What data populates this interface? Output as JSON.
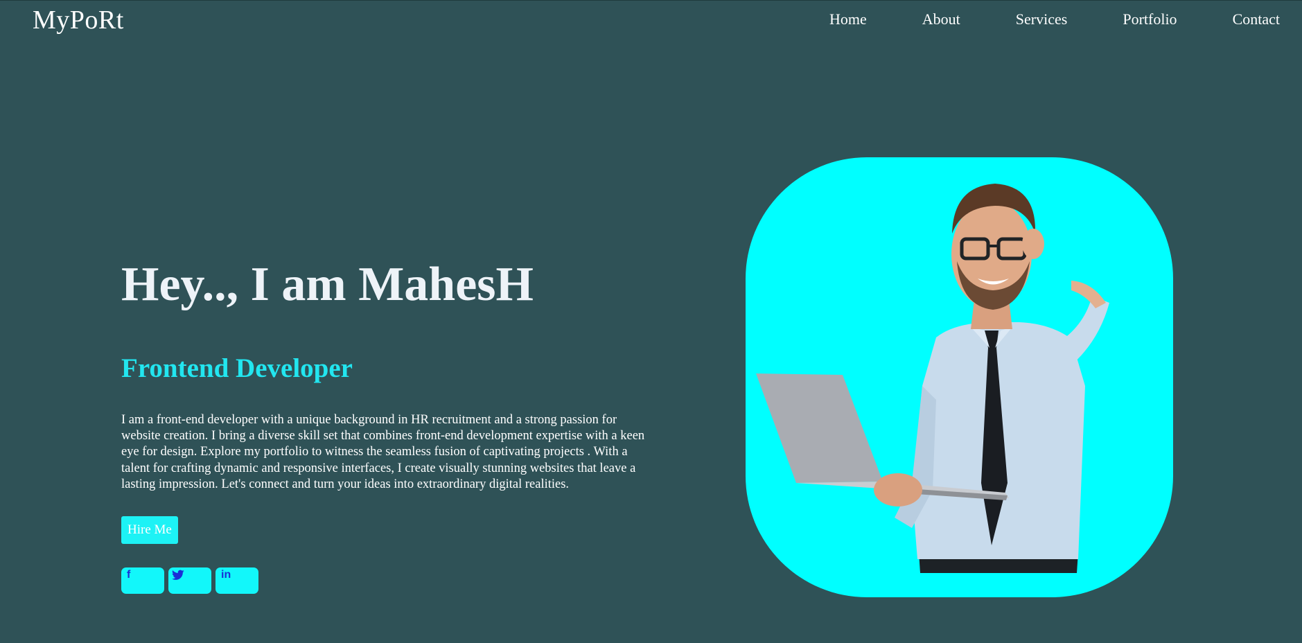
{
  "brand": {
    "logo_text": "MyPoRt"
  },
  "nav": {
    "items": [
      {
        "label": "Home"
      },
      {
        "label": "About"
      },
      {
        "label": "Services"
      },
      {
        "label": "Portfolio"
      },
      {
        "label": "Contact"
      }
    ]
  },
  "hero": {
    "title": "Hey.., I am MahesH",
    "subtitle": "Frontend Developer",
    "description": "I am a front-end developer with a unique background in HR recruitment and a strong passion for website creation. I bring a diverse skill set that combines front-end development expertise with a keen eye for design. Explore my portfolio to witness the seamless fusion of captivating projects . With a talent for crafting dynamic and responsive interfaces, I create visually stunning websites that leave a lasting impression. Let's connect and turn your ideas into extraordinary digital realities.",
    "hire_button_label": "Hire Me"
  },
  "social": {
    "facebook_glyph": "f",
    "linkedin_glyph": "in",
    "icons": [
      "facebook-icon",
      "twitter-icon",
      "linkedin-icon"
    ]
  },
  "photo": {
    "subject": "portrait of a smiling man in glasses, shirt and tie holding a laptop"
  },
  "colors": {
    "background": "#2f5257",
    "accent": "#00ffff",
    "subtitle": "#22e6f0",
    "social_icon": "#1a2fd6"
  }
}
